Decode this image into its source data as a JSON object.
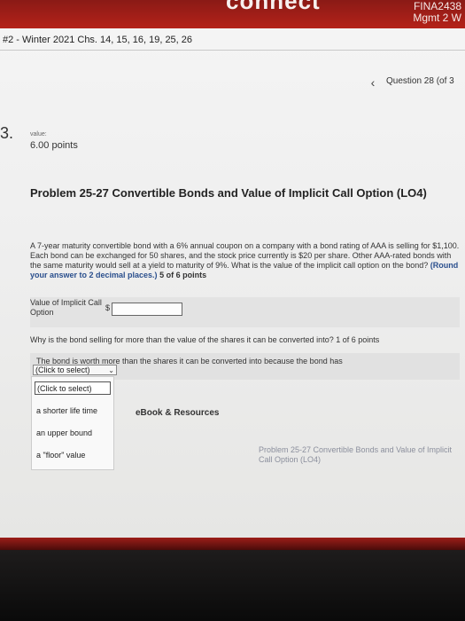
{
  "header": {
    "brand": "connect",
    "course_code": "FINA2438",
    "course_name": "Mgmt 2 W"
  },
  "assignment": {
    "title": "#2 - Winter 2021 Chs. 14, 15, 16, 19, 25, 26"
  },
  "nav": {
    "prev_icon": "chevron-left-icon",
    "question_label": "Question 28 (of 3"
  },
  "question": {
    "number": "3.",
    "value_label": "value:",
    "points": "6.00 points",
    "title": "Problem 25-27 Convertible Bonds and Value of Implicit Call Option (LO4)",
    "body": "A 7-year maturity convertible bond with a 6% annual coupon on a company with a bond rating of AAA is selling for $1,100. Each bond can be exchanged for 50 shares, and the stock price currently is $20 per share. Other AAA-rated bonds with the same maturity would sell at a yield to maturity of 9%. What is the value of the implicit call option on the bond?",
    "instruction": "(Round your answer to 2 decimal places.)",
    "progress1": "5 of 6 points"
  },
  "answer1": {
    "label": "Value of Implicit Call Option",
    "currency": "$",
    "value": ""
  },
  "question2": {
    "text": "Why is the bond selling for more than the value of the shares it can be converted into?",
    "progress": "1 of 6 points"
  },
  "answer2": {
    "statement": "The bond is worth more than the shares it can be converted into because the bond has",
    "selected": "(Click to select)",
    "options": [
      "(Click to select)",
      "a shorter life time",
      "an upper bound",
      "a \"floor\" value"
    ]
  },
  "resources": {
    "ebook_label": "eBook & Resources"
  },
  "next_problem": {
    "label": "Problem 25-27 Convertible Bonds and Value of Implicit Call Option (LO4)"
  },
  "colors": {
    "brand_red": "#b52219",
    "instruction_blue": "#2a4f8d",
    "link_gray": "#8b8f9d"
  }
}
